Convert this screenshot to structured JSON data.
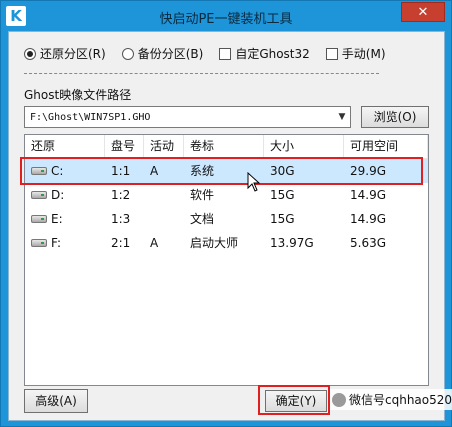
{
  "window": {
    "title": "快启动PE一键装机工具",
    "icon_letter": "K",
    "close_symbol": "✕"
  },
  "options": [
    {
      "kind": "radio",
      "label": "还原分区(R)",
      "checked": true
    },
    {
      "kind": "radio",
      "label": "备份分区(B)",
      "checked": false
    },
    {
      "kind": "checkbox",
      "label": "自定Ghost32",
      "checked": false
    },
    {
      "kind": "checkbox",
      "label": "手动(M)",
      "checked": false
    }
  ],
  "ghost_path": {
    "label": "Ghost映像文件路径",
    "value": "F:\\Ghost\\WIN7SP1.GHO",
    "browse_label": "浏览(O)"
  },
  "table": {
    "columns": [
      "还原",
      "盘号",
      "活动",
      "卷标",
      "大小",
      "可用空间"
    ],
    "rows": [
      {
        "drive": "C:",
        "disk": "1:1",
        "active": "A",
        "label": "系统",
        "size": "30G",
        "free": "29.9G",
        "selected": true
      },
      {
        "drive": "D:",
        "disk": "1:2",
        "active": "",
        "label": "软件",
        "size": "15G",
        "free": "14.9G",
        "selected": false
      },
      {
        "drive": "E:",
        "disk": "1:3",
        "active": "",
        "label": "文档",
        "size": "15G",
        "free": "14.9G",
        "selected": false
      },
      {
        "drive": "F:",
        "disk": "2:1",
        "active": "A",
        "label": "启动大师",
        "size": "13.97G",
        "free": "5.63G",
        "selected": false
      }
    ]
  },
  "buttons": {
    "advanced": "高级(A)",
    "ok": "确定(Y)"
  },
  "watermark": "微信号cqhhao520",
  "colors": {
    "titlebar": "#1d95d8",
    "selection": "#cce8ff",
    "highlight": "#e02020",
    "close": "#c7402f"
  }
}
